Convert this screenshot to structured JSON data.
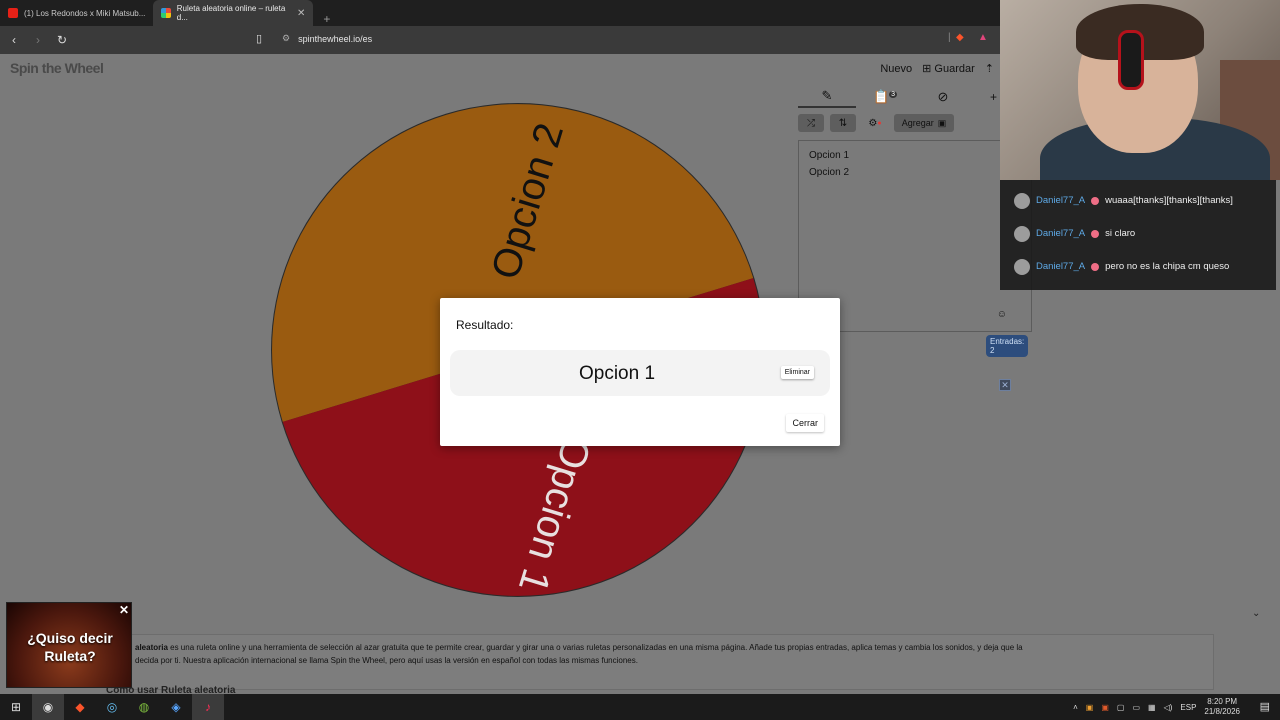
{
  "browser": {
    "tabs": [
      {
        "label": "(1) Los Redondos x Miki Matsub...",
        "active": false
      },
      {
        "label": "Ruleta aleatoria online – ruleta d...",
        "active": true
      }
    ],
    "new_tab": "+",
    "url": "spinthewheel.io/es"
  },
  "page": {
    "logo": "Spin the Wheel",
    "header": {
      "new_label": "Nuevo",
      "save_label": "Guardar"
    },
    "wheel": {
      "segments": [
        {
          "label": "Opcion 2",
          "color": "#9a5b10"
        },
        {
          "label": "Opcion 1",
          "color": "#8e1019"
        }
      ]
    },
    "panel": {
      "add_label": "Agregar",
      "badge": "3",
      "entries": [
        "Opcion 1",
        "Opcion 2"
      ],
      "entries_count": "Entradas: 2"
    },
    "dialog": {
      "title": "Resultado:",
      "result": "Opcion 1",
      "remove_label": "Eliminar",
      "close_label": "Cerrar"
    },
    "article": {
      "bold": "aleatoria",
      "line1": " es una ruleta online y una herramienta de selección al azar gratuita que te permite crear, guardar y girar una o varias ruletas personalizadas en una misma página. Añade tus propias entradas, aplica temas y cambia los sonidos, y deja que la",
      "line2": "decida por ti. Nuestra aplicación internacional se llama Spin the Wheel, pero aquí usas la versión en español con todas las mismas funciones.",
      "subheading": "Cómo usar Ruleta aleatoria"
    },
    "ad": {
      "text": "¿Quiso decir Ruleta?"
    }
  },
  "chat": {
    "messages": [
      {
        "user": "Daniel77_A",
        "text": "wuaaa[thanks][thanks][thanks]"
      },
      {
        "user": "Daniel77_A",
        "text": "si claro"
      },
      {
        "user": "Daniel77_A",
        "text": "pero no es la chipa cm queso"
      }
    ]
  },
  "taskbar": {
    "lang": "ESP",
    "time": "8:20 PM",
    "date": "21/8/2026"
  }
}
